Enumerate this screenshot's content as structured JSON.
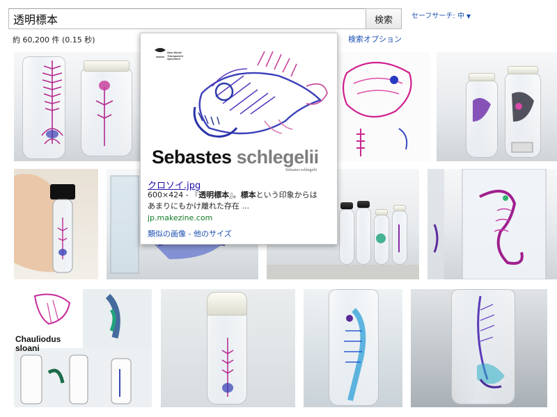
{
  "search": {
    "query": "透明標本",
    "button_label": "検索",
    "safesearch_label": "セーフサーチ: 中",
    "safesearch_caret": "▼",
    "result_stats": "約 60,200 件 (0.15 秒)",
    "options_label": "検索オプション"
  },
  "hover_card": {
    "image_caption_main": "Sebastes",
    "image_caption_second": "schlegelii",
    "image_caption_small": "Sebastes schlegelii",
    "image_logo_line1": "New World",
    "image_logo_line2": "Transparent",
    "image_logo_line3": "Specimen",
    "title": "クロソイ.jpg",
    "dimensions": "600×424 - 『",
    "desc_bold": "透明標本",
    "desc_rest": "』。",
    "desc_bold2": "標本",
    "desc_rest2": "という印象からは",
    "desc_line2": "あまりにもかけ離れた存在 ...",
    "url": "jp.makezine.com",
    "similar_link": "類似の画像",
    "separator": " - ",
    "sizes_link": "他のサイズ"
  },
  "thumbnails": {
    "thumb9_text_line1": "Chauliodus",
    "thumb9_text_line2": "sloani"
  },
  "colors": {
    "link": "#1a4fb0",
    "title_link": "#1a0dab",
    "url_green": "#0e7a23",
    "specimen_magenta": "#c2188f",
    "specimen_blue": "#2d3fb8",
    "specimen_purple": "#7a2a9a"
  },
  "icons": {
    "caret": "triangle-down"
  }
}
